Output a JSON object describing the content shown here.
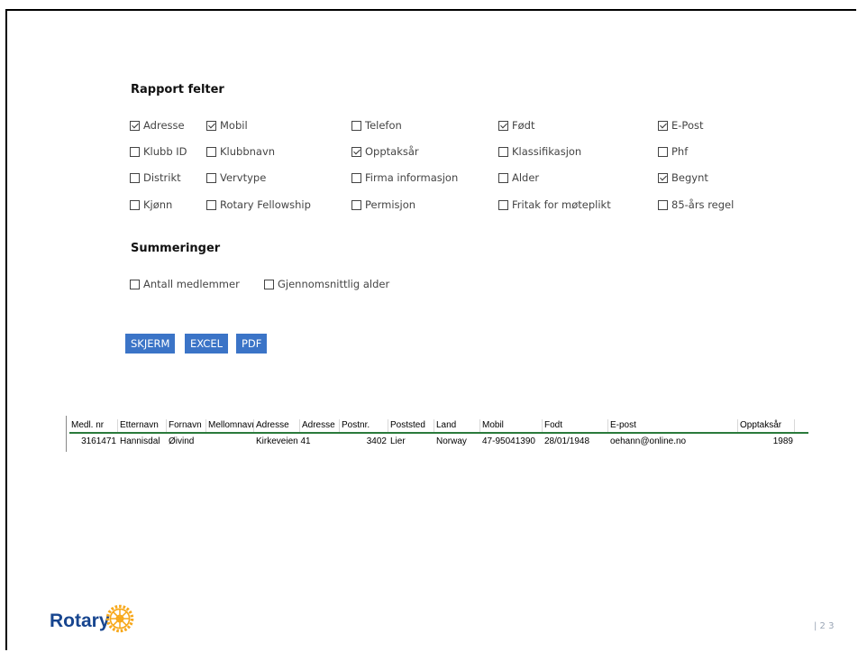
{
  "report_fields": {
    "title": "Rapport felter",
    "items": [
      {
        "label": "Adresse",
        "checked": true
      },
      {
        "label": "Mobil",
        "checked": true
      },
      {
        "label": "Telefon",
        "checked": false
      },
      {
        "label": "Født",
        "checked": true
      },
      {
        "label": "E-Post",
        "checked": true
      },
      {
        "label": "Klubb ID",
        "checked": false
      },
      {
        "label": "Klubbnavn",
        "checked": false
      },
      {
        "label": "Opptaksår",
        "checked": true
      },
      {
        "label": "Klassifikasjon",
        "checked": false
      },
      {
        "label": "Phf",
        "checked": false
      },
      {
        "label": "Distrikt",
        "checked": false
      },
      {
        "label": "Vervtype",
        "checked": false
      },
      {
        "label": "Firma informasjon",
        "checked": false
      },
      {
        "label": "Alder",
        "checked": false
      },
      {
        "label": "Begynt",
        "checked": true
      },
      {
        "label": "Kjønn",
        "checked": false
      },
      {
        "label": "Rotary Fellowship",
        "checked": false
      },
      {
        "label": "Permisjon",
        "checked": false
      },
      {
        "label": "Fritak for møteplikt",
        "checked": false
      },
      {
        "label": "85-års regel",
        "checked": false
      }
    ]
  },
  "summaries": {
    "title": "Summeringer",
    "items": [
      {
        "label": "Antall medlemmer",
        "checked": false
      },
      {
        "label": "Gjennomsnittlig alder",
        "checked": false
      }
    ]
  },
  "buttons": {
    "screen": "SKJERM",
    "excel": "EXCEL",
    "pdf": "PDF"
  },
  "table": {
    "headers": [
      "Medl. nr",
      "Etternavn",
      "Fornavn",
      "Mellomnavn",
      "Adresse",
      "Adresse",
      "Postnr.",
      "Poststed",
      "Land",
      "Mobil",
      "Fodt",
      "E-post",
      "Opptaksår"
    ],
    "rows": [
      [
        "3161471",
        "Hannisdal",
        "Øivind",
        "",
        "Kirkeveien 41",
        "",
        "3402",
        "Lier",
        "Norway",
        "47-95041390",
        "28/01/1948",
        "oehann@online.no",
        "1989"
      ]
    ]
  },
  "footer": {
    "logo_text": "Rotary",
    "page": "| 2 3"
  },
  "colors": {
    "button": "#3b74c7",
    "brand_blue": "#17458f",
    "brand_gold": "#f7a81b",
    "header_rule": "#2b7a3c"
  }
}
